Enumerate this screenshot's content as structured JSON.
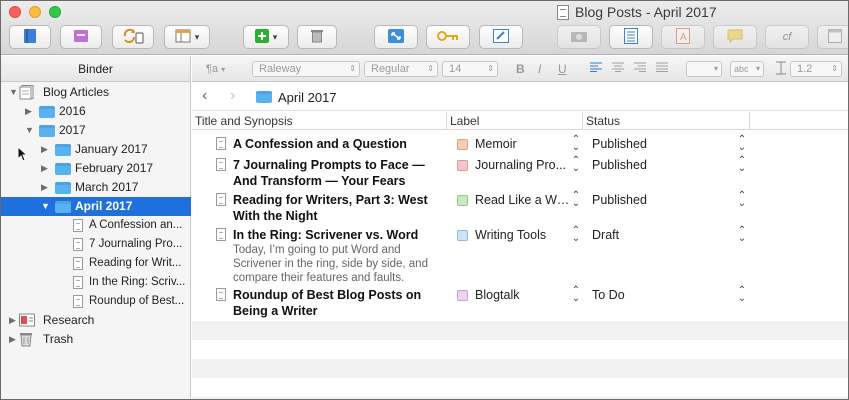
{
  "window": {
    "title": "Blog Posts - April 2017"
  },
  "toolbar": {
    "buttons": [
      {
        "name": "binder-toggle",
        "icon": "binder-icon"
      },
      {
        "name": "inspector-toggle",
        "icon": "inspector-icon"
      },
      {
        "name": "sync",
        "icon": "sync-icon"
      },
      {
        "name": "view-mode",
        "icon": "view-mode-icon"
      },
      {
        "name": "add",
        "icon": "add-icon"
      },
      {
        "name": "trash",
        "icon": "trash-icon"
      },
      {
        "name": "composition",
        "icon": "fullscreen-icon"
      },
      {
        "name": "keywords",
        "icon": "key-icon"
      },
      {
        "name": "edit",
        "icon": "edit-icon"
      },
      {
        "name": "snapshot",
        "icon": "camera-icon"
      },
      {
        "name": "outline",
        "icon": "list-icon"
      },
      {
        "name": "format",
        "icon": "format-icon"
      },
      {
        "name": "comment",
        "icon": "comment-icon"
      },
      {
        "name": "footnote",
        "icon": "footnote-icon"
      },
      {
        "name": "panel",
        "icon": "panel-icon"
      }
    ],
    "footnote_label": "cf"
  },
  "formatbar": {
    "paragraph_icon": "¶a",
    "font_family": "Raleway",
    "font_style": "Regular",
    "font_size": "14",
    "bold": "B",
    "italic": "I",
    "underline": "U",
    "highlight": "abc",
    "line_spacing": "1.2"
  },
  "binder": {
    "header": "Binder",
    "items": [
      {
        "label": "Blog Articles",
        "level": 0,
        "kind": "root",
        "expanded": true
      },
      {
        "label": "2016",
        "level": 1,
        "kind": "folder",
        "expanded": false
      },
      {
        "label": "2017",
        "level": 1,
        "kind": "folder",
        "expanded": true
      },
      {
        "label": "January 2017",
        "level": 2,
        "kind": "folder",
        "expanded": false
      },
      {
        "label": "February 2017",
        "level": 2,
        "kind": "folder",
        "expanded": false
      },
      {
        "label": "March 2017",
        "level": 2,
        "kind": "folder",
        "expanded": false
      },
      {
        "label": "April 2017",
        "level": 2,
        "kind": "folder",
        "expanded": true,
        "selected": true
      },
      {
        "label": "A Confession an...",
        "level": 3,
        "kind": "doc"
      },
      {
        "label": "7 Journaling Pro...",
        "level": 3,
        "kind": "doc"
      },
      {
        "label": "Reading for Writ...",
        "level": 3,
        "kind": "doc"
      },
      {
        "label": "In the Ring: Scriv...",
        "level": 3,
        "kind": "doc"
      },
      {
        "label": "Roundup of Best...",
        "level": 3,
        "kind": "doc"
      },
      {
        "label": "Research",
        "level": 0,
        "kind": "research",
        "expanded": false
      },
      {
        "label": "Trash",
        "level": 0,
        "kind": "trash",
        "expanded": false
      }
    ]
  },
  "nav": {
    "back": "‹",
    "forward": "›",
    "current": "April 2017"
  },
  "outline": {
    "columns": [
      "Title and Synopsis",
      "Label",
      "Status"
    ],
    "rows": [
      {
        "title": "A Confession and a Question",
        "synopsis": "",
        "label": "Memoir",
        "label_color": "#f7cfb7",
        "label_border": "#d9a584",
        "status": "Published"
      },
      {
        "title": "7 Journaling Prompts to Face — And Transform — Your Fears",
        "synopsis": "",
        "label": "Journaling Pro...",
        "label_color": "#f6c6cc",
        "label_border": "#d89aa2",
        "status": "Published"
      },
      {
        "title": "Reading for Writers, Part 3: West With the Night",
        "synopsis": "",
        "label": "Read Like a Wri...",
        "label_color": "#c9eac4",
        "label_border": "#94c78d",
        "status": "Published"
      },
      {
        "title": "In the Ring: Scrivener vs. Word",
        "synopsis": "Today, I’m going to put Word and Scrivener in the ring, side by side, and compare their features and faults.",
        "label": "Writing Tools",
        "label_color": "#cde3f6",
        "label_border": "#8fb8dc",
        "status": "Draft"
      },
      {
        "title": "Roundup of Best Blog Posts on Being a Writer",
        "synopsis": "",
        "label": "Blogtalk",
        "label_color": "#efd4f2",
        "label_border": "#c79fcc",
        "status": "To Do"
      }
    ]
  }
}
